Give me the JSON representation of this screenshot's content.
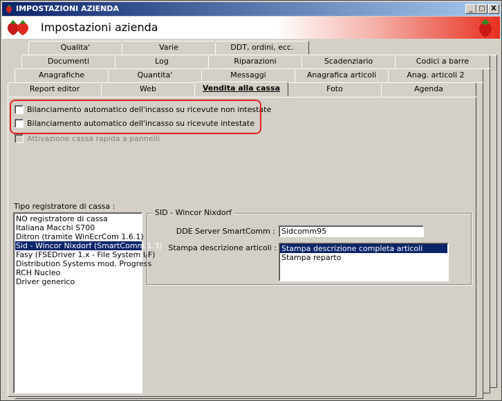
{
  "window": {
    "title": "IMPOSTAZIONI AZIENDA",
    "banner_title": "Impostazioni azienda",
    "controls": {
      "minimize": "_",
      "maximize": "□",
      "close": "X"
    }
  },
  "tabs": {
    "row1": [
      "Qualita'",
      "Varie",
      "DDT, ordini, ecc."
    ],
    "row2": [
      "Documenti",
      "Log",
      "Riparazioni",
      "Scadenziario",
      "Codici a barre"
    ],
    "row3": [
      "Anagrafiche",
      "Quantita'",
      "Messaggi",
      "Anagrafica articoli",
      "Anag. articoli 2"
    ],
    "row4": [
      "Report editor",
      "Web",
      "Vendita alla cassa",
      "Foto",
      "Agenda"
    ],
    "active": "Vendita alla cassa"
  },
  "checkboxes": [
    {
      "label": "Bilanciamento automatico dell'incasso su ricevute non intestate",
      "checked": false
    },
    {
      "label": "Bilanciamento automatico dell'incasso su ricevute intestate",
      "checked": false
    },
    {
      "label": "Attivazione cassa rapida a pannelli",
      "checked": false,
      "disabled": true
    }
  ],
  "register": {
    "label": "Tipo registratore di cassa :",
    "items": [
      "NO registratore di cassa",
      "Italiana Macchi S700",
      "Ditron (tramite WinEcrCom 1.6.1)",
      "Sid - Wincor Nixdorf (SmartComm 1.3)",
      "Fasy (FSEDriver 1.x - File System I/F)",
      "Distribution Systems mod. Progress",
      "RCH Nucleo",
      "Driver generico"
    ],
    "selected": "Sid - Wincor Nixdorf (SmartComm 1.3)"
  },
  "sid_group": {
    "legend": "SID - Wincor Nixdorf",
    "dde_label": "DDE Server SmartComm :",
    "dde_value": "Sidcomm95",
    "stampa_label": "Stampa descrizione articoli :",
    "stampa_options": [
      "Stampa descrizione completa articoli",
      "Stampa reparto"
    ],
    "stampa_selected": "Stampa descrizione completa articoli"
  },
  "icons": {
    "app": "strawberry-icon",
    "banner": "strawberries-icon",
    "banner_right": "strawberry-icon"
  },
  "colors": {
    "titlebar": "#0a246a",
    "highlight": "#e02020",
    "selection": "#0a246a"
  }
}
